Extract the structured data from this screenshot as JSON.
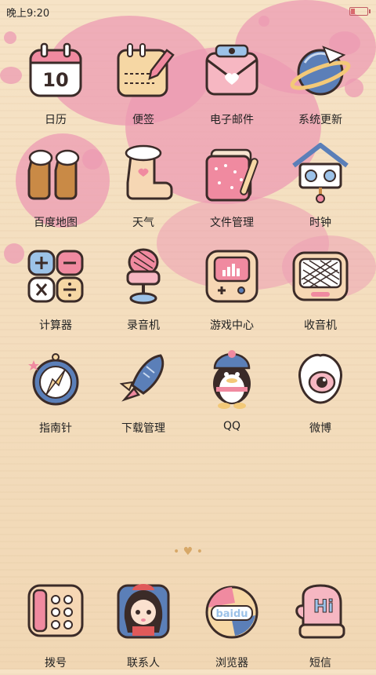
{
  "status_bar": {
    "time": "晚上9:20",
    "battery_level": 0.3
  },
  "apps": [
    {
      "id": "calendar",
      "label": "日历",
      "icon": "calendar-icon",
      "badge": "10"
    },
    {
      "id": "notes",
      "label": "便签",
      "icon": "notepad-icon"
    },
    {
      "id": "email",
      "label": "电子邮件",
      "icon": "envelope-icon"
    },
    {
      "id": "system-update",
      "label": "系统更新",
      "icon": "planet-icon"
    },
    {
      "id": "baidu-map",
      "label": "百度地图",
      "icon": "boots-icon"
    },
    {
      "id": "weather",
      "label": "天气",
      "icon": "boot-icon"
    },
    {
      "id": "file-manager",
      "label": "文件管理",
      "icon": "folder-icon"
    },
    {
      "id": "clock",
      "label": "时钟",
      "icon": "birdhouse-icon"
    },
    {
      "id": "calculator",
      "label": "计算器",
      "icon": "calculator-icon"
    },
    {
      "id": "recorder",
      "label": "录音机",
      "icon": "microphone-icon"
    },
    {
      "id": "game-center",
      "label": "游戏中心",
      "icon": "game-console-icon"
    },
    {
      "id": "radio",
      "label": "收音机",
      "icon": "radio-icon"
    },
    {
      "id": "compass",
      "label": "指南针",
      "icon": "compass-icon"
    },
    {
      "id": "download-manager",
      "label": "下载管理",
      "icon": "rocket-icon"
    },
    {
      "id": "qq",
      "label": "QQ",
      "icon": "penguin-icon"
    },
    {
      "id": "weibo",
      "label": "微博",
      "icon": "eye-icon"
    }
  ],
  "dock": [
    {
      "id": "dialer",
      "label": "拨号",
      "icon": "telephone-icon"
    },
    {
      "id": "contacts",
      "label": "联系人",
      "icon": "contact-girl-icon"
    },
    {
      "id": "browser",
      "label": "浏览器",
      "icon": "browser-ball-icon",
      "badge": "baidu"
    },
    {
      "id": "messages",
      "label": "短信",
      "icon": "mitten-icon",
      "badge": "Hi"
    }
  ],
  "page_indicator": "• ♥ •"
}
